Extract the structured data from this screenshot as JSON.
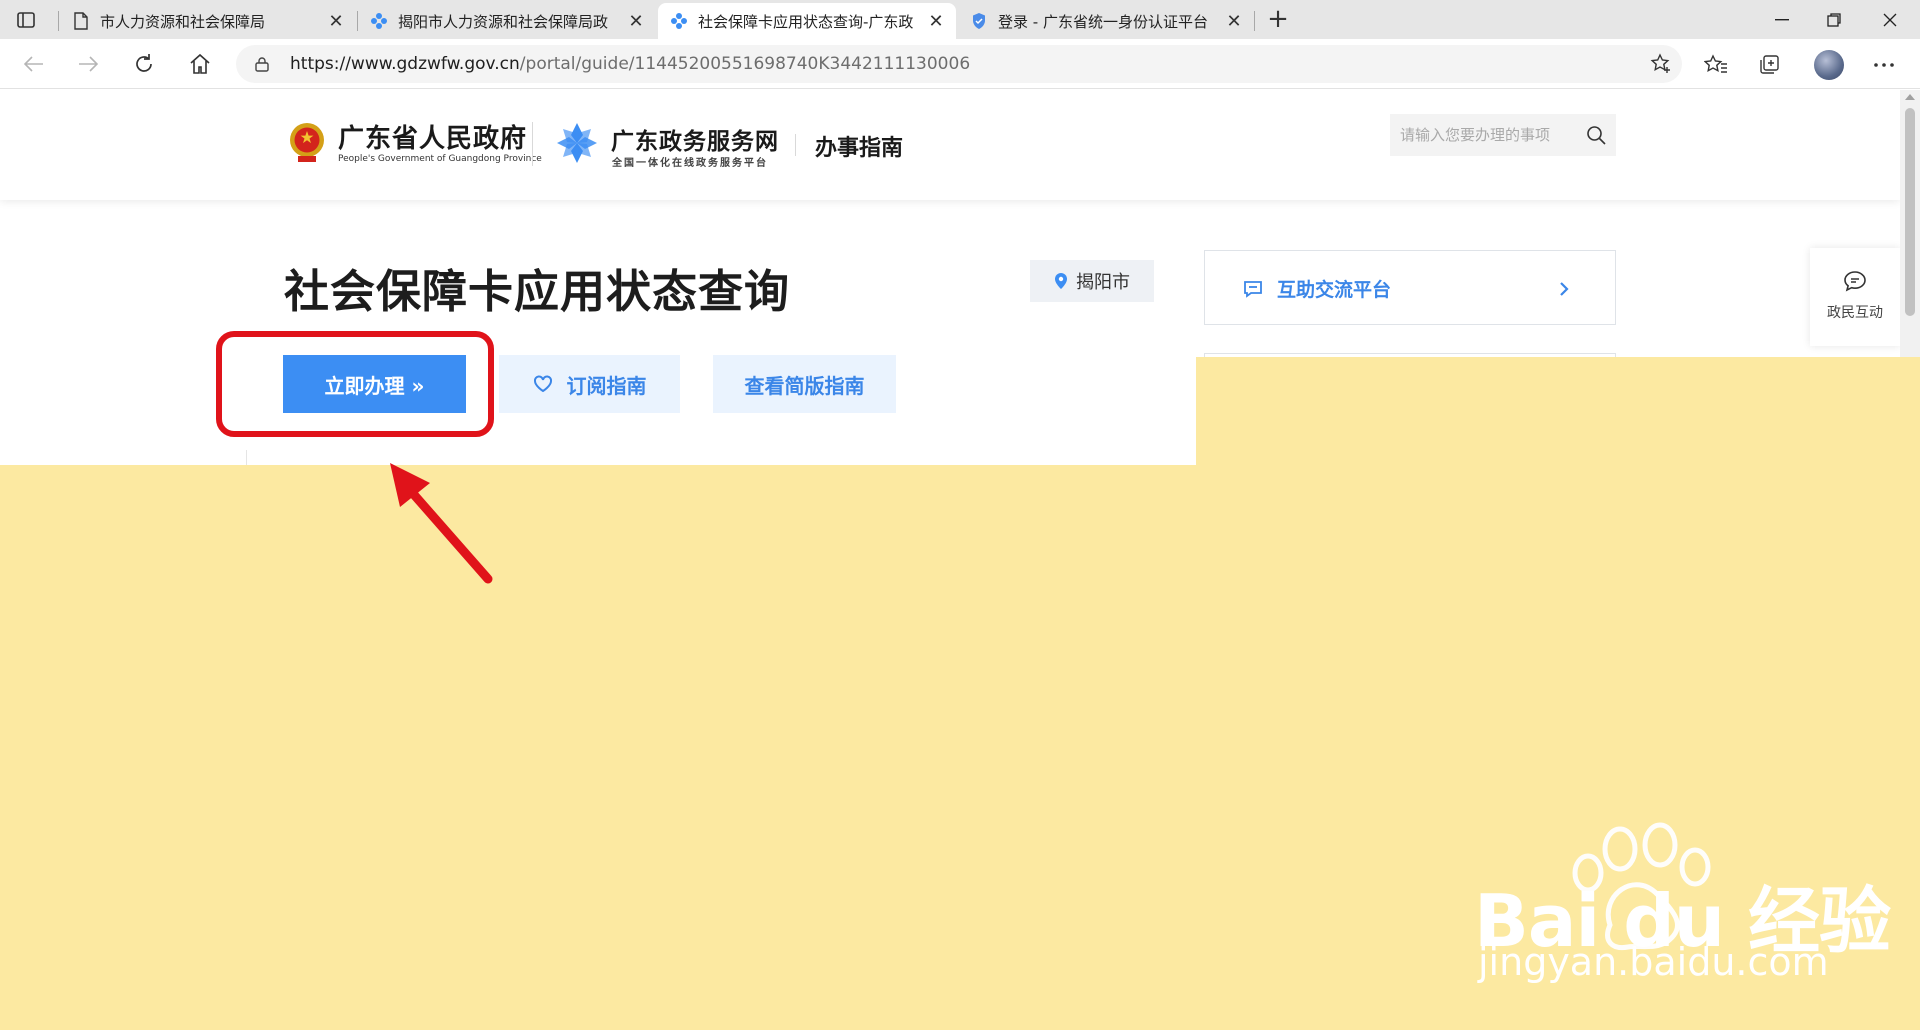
{
  "browser": {
    "tabs": [
      {
        "title": "市人力资源和社会保障局",
        "favicon": "page-icon",
        "active": false
      },
      {
        "title": "揭阳市人力资源和社会保障局政",
        "favicon": "gdzw-icon",
        "active": false
      },
      {
        "title": "社会保障卡应用状态查询-广东政",
        "favicon": "gdzw-icon",
        "active": true
      },
      {
        "title": "登录 - 广东省统一身份认证平台",
        "favicon": "shield-icon",
        "active": false
      }
    ],
    "url_host": "https://www.gdzwfw.gov.cn",
    "url_path": "/portal/guide/11445200551698740K3442111130006"
  },
  "header": {
    "gov_name": "广东省人民政府",
    "gov_name_en": "People's Government of Guangdong Province",
    "portal_name": "广东政务服务网",
    "portal_sub": "全国一体化在线政务服务平台",
    "section": "办事指南",
    "search_placeholder": "请输入您要办理的事项"
  },
  "main": {
    "title": "社会保障卡应用状态查询",
    "region": "揭阳市",
    "apply_label": "立即办理 »",
    "subscribe_label": "订阅指南",
    "simple_label": "查看简版指南"
  },
  "side": {
    "card_title": "互助交流平台",
    "float_label": "政民互动"
  },
  "watermark": {
    "brand": "Bai du 经验",
    "site": "jingyan.baidu.com"
  },
  "colors": {
    "accent": "#3c8ef3",
    "highlight": "#e0131a",
    "mask": "#fce9a1"
  }
}
